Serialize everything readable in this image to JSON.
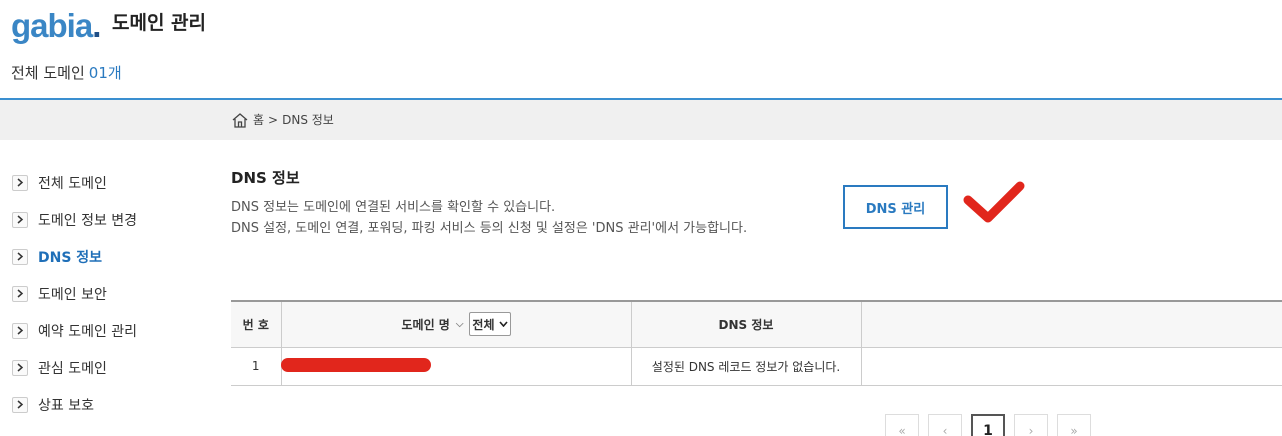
{
  "header": {
    "logo": "gabia",
    "logo_dot": ".",
    "title": "도메인 관리",
    "count_label": "전체 도메인",
    "count_value": "01개"
  },
  "breadcrumb": {
    "home": "홈",
    "separator": ">",
    "current": "DNS 정보"
  },
  "sidebar": {
    "items": [
      {
        "label": "전체 도메인"
      },
      {
        "label": "도메인 정보 변경"
      },
      {
        "label": "DNS 정보"
      },
      {
        "label": "도메인 보안"
      },
      {
        "label": "예약 도메인 관리"
      },
      {
        "label": "관심 도메인"
      },
      {
        "label": "상표 보호"
      }
    ]
  },
  "main": {
    "title": "DNS 정보",
    "desc_line1": "DNS 정보는 도메인에 연결된 서비스를 확인할 수 있습니다.",
    "desc_line2": "DNS 설정, 도메인 연결, 포워딩, 파킹 서비스 등의 신청 및 설정은 'DNS 관리'에서 가능합니다.",
    "button_label": "DNS 관리"
  },
  "table": {
    "headers": {
      "no": "번 호",
      "domain": "도메인 명",
      "filter_value": "전체",
      "dns": "DNS 정보"
    },
    "rows": [
      {
        "no": "1",
        "dns": "설정된 DNS 레코드 정보가 없습니다."
      }
    ]
  },
  "pagination": {
    "current_page": "1"
  },
  "colors": {
    "accent": "#2a7ac0",
    "checkmark": "#e1261c",
    "header_rule": "#3a8fd0"
  }
}
